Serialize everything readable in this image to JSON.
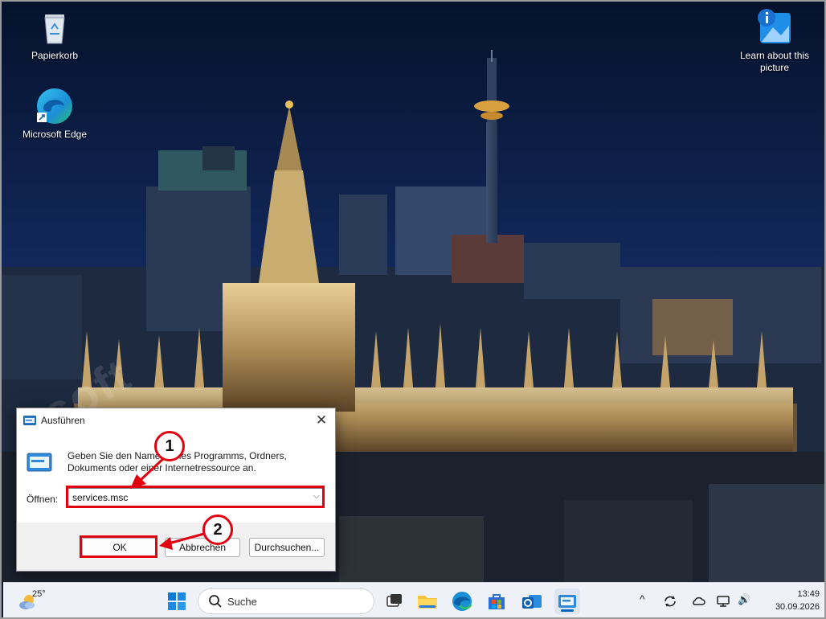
{
  "desktop": {
    "icons": [
      {
        "label": "Papierkorb"
      },
      {
        "label": "Microsoft Edge"
      },
      {
        "label": "Learn about this picture"
      }
    ],
    "watermark": "soft"
  },
  "run_dialog": {
    "title": "Ausführen",
    "close_glyph": "✕",
    "description": "Geben Sie den Namen eines Programms, Ordners, Dokuments oder einer Internetressource an.",
    "open_label": "Öffnen:",
    "open_value": "services.msc",
    "combo_arrow": "⌵",
    "ok_label": "OK",
    "cancel_label": "Abbrechen",
    "browse_label": "Durchsuchen..."
  },
  "annotations": {
    "step1": "1",
    "step2": "2",
    "color": "#e00010"
  },
  "taskbar": {
    "weather_temp": "25°",
    "search_placeholder": "Suche",
    "time": "13:49",
    "date": "30.09.2026",
    "tray_chevron": "^",
    "tray_volume": "🔊",
    "accent": "#0067c0"
  }
}
